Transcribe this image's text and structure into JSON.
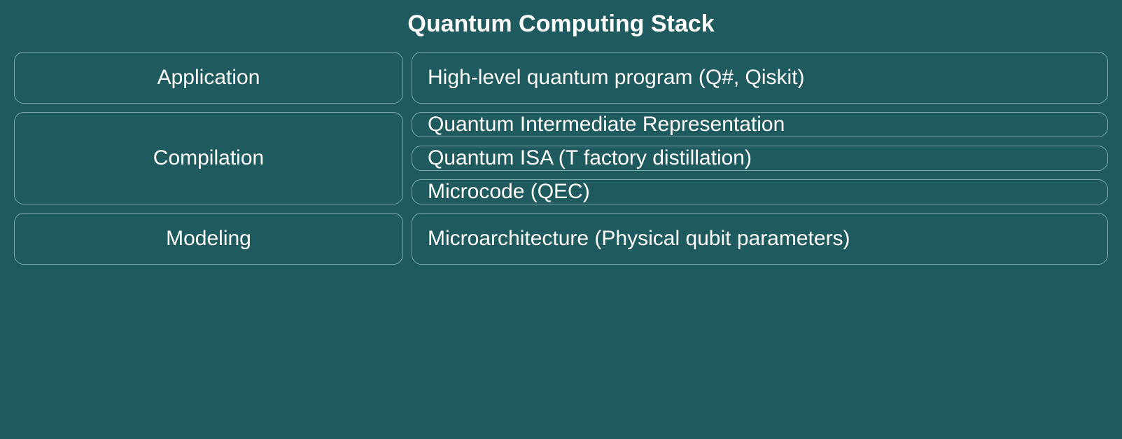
{
  "title": "Quantum Computing Stack",
  "rows": [
    {
      "category": "Application",
      "items": [
        "High-level quantum program (Q#, Qiskit)"
      ]
    },
    {
      "category": "Compilation",
      "items": [
        "Quantum Intermediate Representation",
        "Quantum ISA (T factory distillation)",
        "Microcode (QEC)"
      ]
    },
    {
      "category": "Modeling",
      "items": [
        "Microarchitecture (Physical qubit parameters)"
      ]
    }
  ]
}
